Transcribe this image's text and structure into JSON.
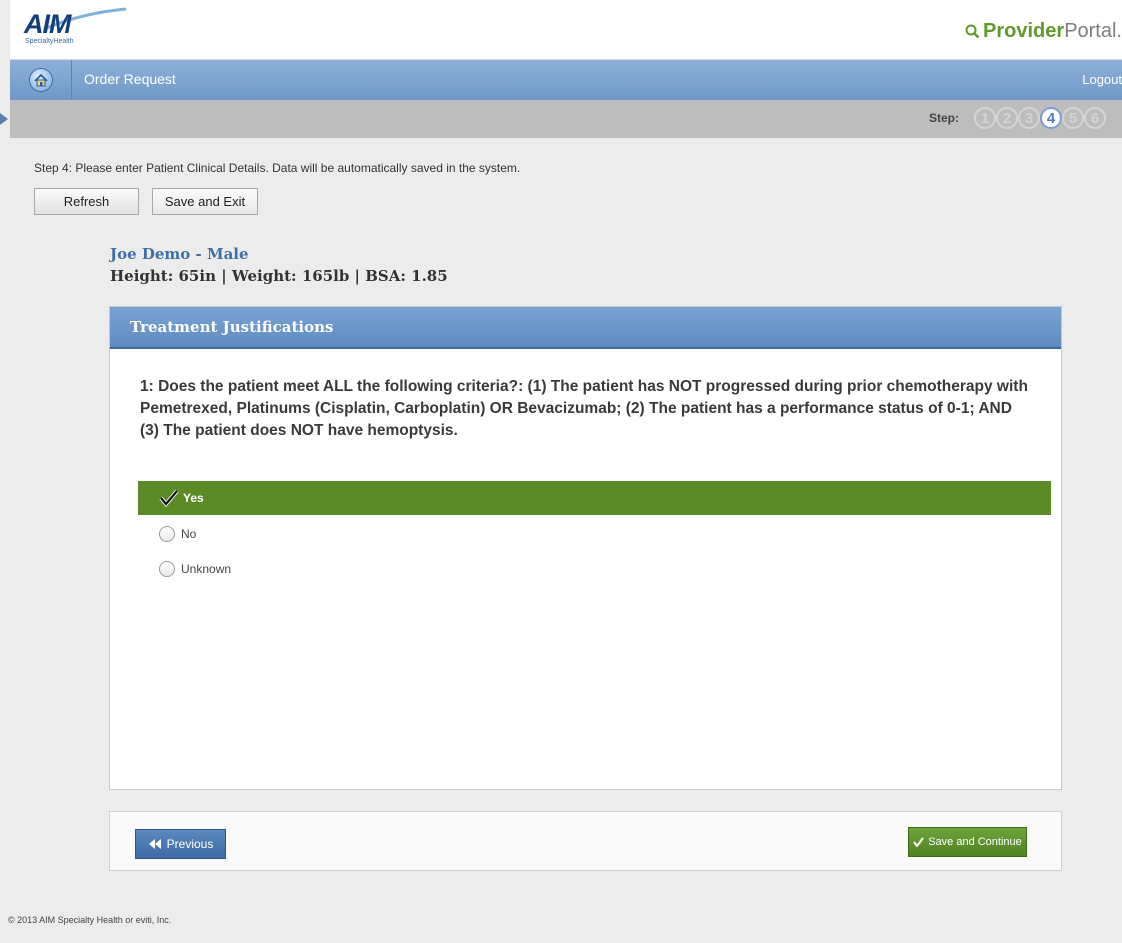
{
  "header": {
    "logo_main": "AIM",
    "logo_sub": "SpecialtyHealth",
    "portal_bold": "Provider",
    "portal_light": "Portal."
  },
  "nav": {
    "title": "Order Request",
    "logout": "Logout"
  },
  "steps": {
    "label": "Step:",
    "items": [
      "1",
      "2",
      "3",
      "4",
      "5",
      "6"
    ],
    "current": 4
  },
  "instructions": "Step 4:  Please enter Patient Clinical Details.  Data will be automatically saved in the system.",
  "buttons": {
    "refresh": "Refresh",
    "save_exit": "Save and Exit",
    "previous": "Previous",
    "save_continue": "Save and Continue"
  },
  "patient": {
    "name_line": "Joe Demo  - Male",
    "stats_line": "Height: 65in  |  Weight:  165lb  |  BSA: 1.85"
  },
  "panel": {
    "title": "Treatment Justifications",
    "question": "1: Does the patient meet ALL the following criteria?: (1) The patient has NOT progressed during prior chemotherapy with Pemetrexed, Platinums (Cisplatin, Carboplatin) OR Bevacizumab; (2) The patient has a performance status of 0-1; AND (3) The patient does NOT have hemoptysis.",
    "answers": [
      {
        "label": "Yes",
        "selected": true
      },
      {
        "label": "No",
        "selected": false
      },
      {
        "label": "Unknown",
        "selected": false
      }
    ]
  },
  "footer": {
    "copyright": "© 2013 AIM Specialty Health or eviti, Inc."
  },
  "colors": {
    "nav_blue": "#7aa3d2",
    "selected_green": "#5c8a27",
    "brand_green": "#5f9a2e",
    "brand_navy": "#123f7a"
  }
}
